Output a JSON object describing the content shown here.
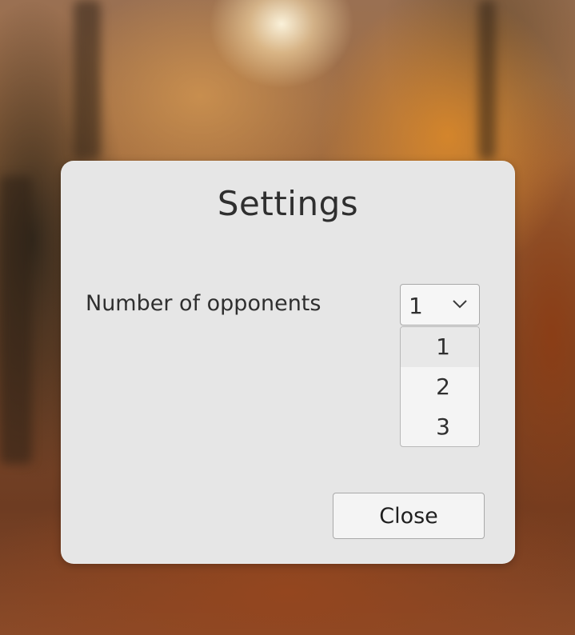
{
  "dialog": {
    "title": "Settings",
    "opponents": {
      "label": "Number of opponents",
      "selected": "1",
      "options": [
        "1",
        "2",
        "3"
      ]
    },
    "close_label": "Close"
  },
  "icons": {
    "dropdown": "chevron-down-icon"
  },
  "colors": {
    "dialog_background": "#e6e6e6",
    "text": "#2f2f2f",
    "border": "#a9a9a9"
  }
}
